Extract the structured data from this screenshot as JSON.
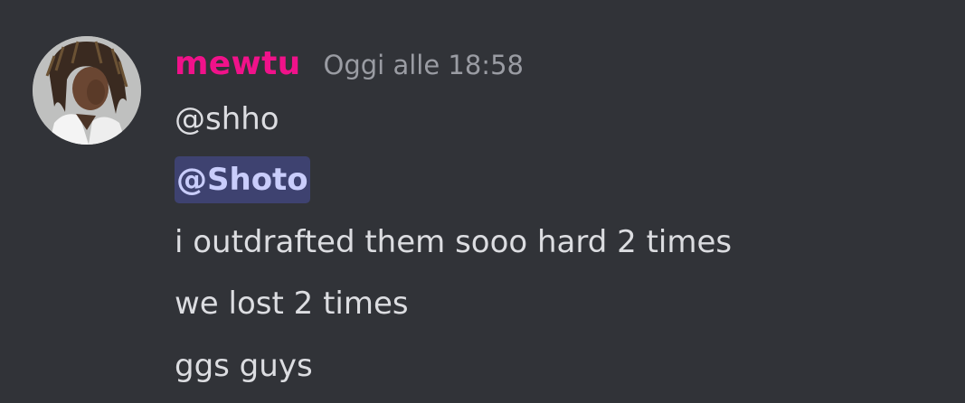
{
  "message": {
    "author": {
      "username": "mewtu",
      "name_color": "#f0128a",
      "avatar_icon": "user-avatar"
    },
    "timestamp": "Oggi alle 18:58",
    "lines": [
      "@shho",
      "@Shoto",
      "i outdrafted them sooo hard 2 times",
      "we lost 2 times",
      "ggs guys"
    ],
    "mention_line_index": 1
  },
  "colors": {
    "background": "#313338",
    "text": "#dcdde1",
    "timestamp": "#9a9ca3",
    "mention_bg": "#3e4270",
    "mention_text": "#c9cdfb"
  }
}
